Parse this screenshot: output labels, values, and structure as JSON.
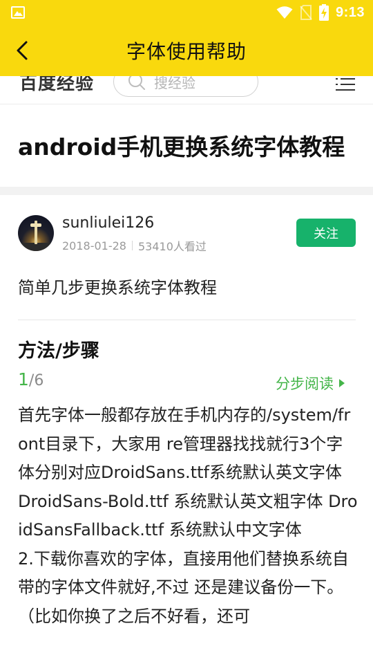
{
  "status_bar": {
    "time": "9:13",
    "icons": [
      "gallery-icon",
      "wifi-icon",
      "no-sim-icon",
      "battery-charging-icon"
    ]
  },
  "header": {
    "back_icon": "chevron-left-icon",
    "title": "字体使用帮助"
  },
  "site_header": {
    "logo": "百度经验",
    "search_placeholder": "搜经验",
    "menu_icon": "menu-icon"
  },
  "article": {
    "title": "android手机更换系统字体教程",
    "author": {
      "name": "sunliulei126",
      "date": "2018-01-28",
      "views": "53410人看过",
      "follow_label": "关注"
    },
    "summary": "简单几步更换系统字体教程",
    "section_title": "方法/步骤",
    "step": {
      "current": "1",
      "total": "/6",
      "read_label": "分步阅读"
    },
    "step_paragraphs": [
      "首先字体一般都存放在手机内存的/system/front目录下，大家用 re管理器找找就行3个字体分别对应DroidSans.ttf系统默认英文字体 DroidSans-Bold.ttf 系统默认英文粗字体 DroidSansFallback.ttf 系统默认中文字体",
      "2.下载你喜欢的字体，直接用他们替换系统自带的字体文件就好,不过 还是建议备份一下。（比如你换了之后不好看，还可"
    ]
  },
  "colors": {
    "header_bg": "#f9d90d",
    "follow_bg": "#17b26b",
    "accent_green": "#44b549"
  }
}
